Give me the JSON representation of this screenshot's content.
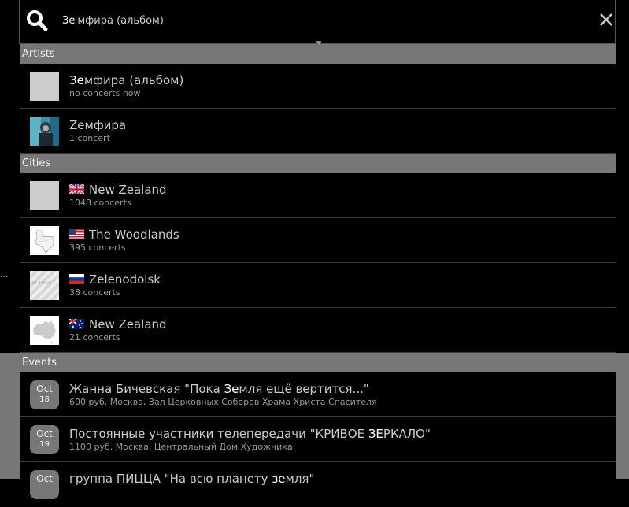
{
  "search": {
    "typed": "Зе",
    "rest": "мфира (альбом)",
    "value": "Земфира (альбом)"
  },
  "background": {
    "glyph": "···"
  },
  "sections": {
    "artists": "Artists",
    "cities": "Cities",
    "events": "Events"
  },
  "artists": [
    {
      "match": "Зе",
      "rest": "мфира (альбом)",
      "sub": "no concerts now",
      "thumb": "placeholder"
    },
    {
      "match": "",
      "rest": "Zeмфира",
      "sub": "1 concert",
      "thumb": "artist-photo"
    }
  ],
  "cities": [
    {
      "name": "New Zealand",
      "sub": "1048 concerts",
      "flag": "gb-flag-icon",
      "thumb": "placeholder"
    },
    {
      "name": "The Woodlands",
      "sub": "395 concerts",
      "flag": "us-flag-icon",
      "thumb": "texas-map"
    },
    {
      "name": "Zelenodolsk",
      "sub": "38 concerts",
      "flag": "ru-flag-icon",
      "thumb": "no-image"
    },
    {
      "name": "New Zealand",
      "sub": "21 concerts",
      "flag": "au-flag-icon",
      "thumb": "australia-map"
    }
  ],
  "no_image_text": "NO IMAGE",
  "events": [
    {
      "month": "Oct",
      "day": "18",
      "pre": "Жанна Бичевская \"Пока ",
      "match": "Зе",
      "post": "мля ещё вертится...\"",
      "sub": "600 руб, Москва, Зал Церковных Соборов Храма Христа Спасителя"
    },
    {
      "month": "Oct",
      "day": "19",
      "pre": "Постоянные участники телепередачи \"КРИВОЕ ",
      "match": "ЗЕ",
      "post": "РКАЛО\"",
      "sub": "1100 руб, Москва, Центральный Дом Художника"
    },
    {
      "month": "Oct",
      "day": "",
      "pre": "группа ПИЦЦА \"На всю планету ",
      "match": "зе",
      "post": "мля\"",
      "sub": ""
    }
  ],
  "colors": {
    "section_bg": "#777777",
    "panel_bg": "#000000",
    "badge_bg": "#777777"
  }
}
